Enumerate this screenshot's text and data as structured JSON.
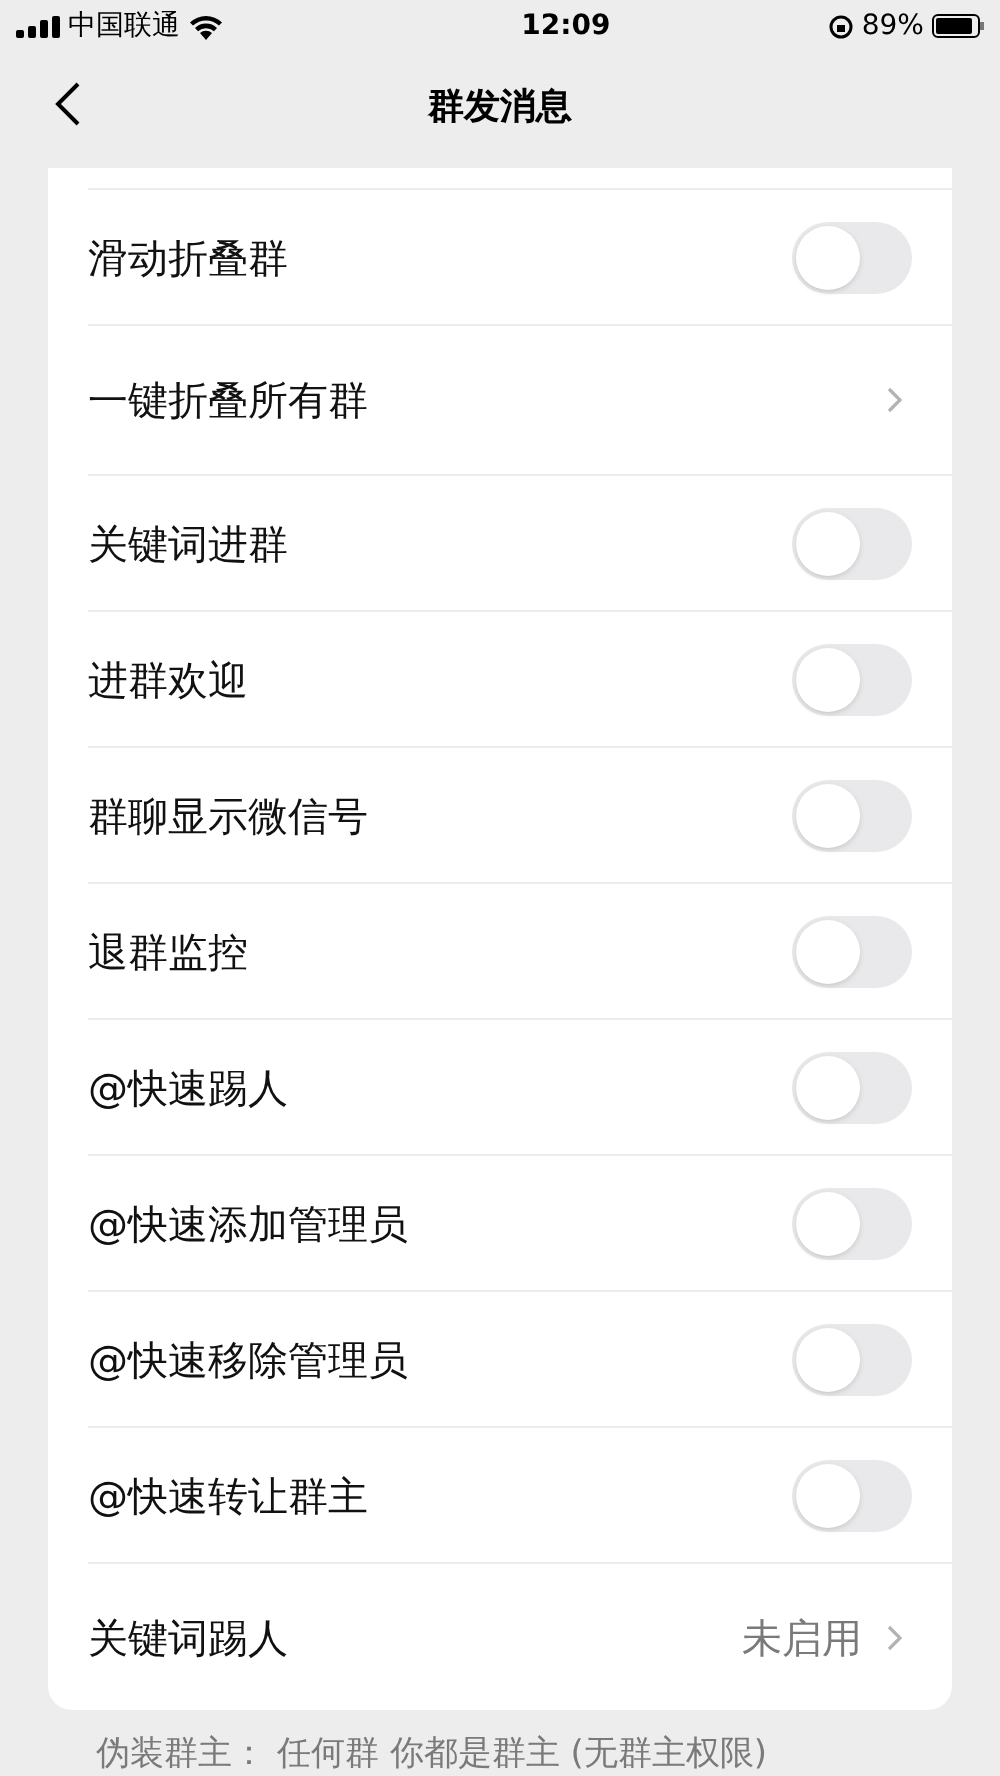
{
  "status_bar": {
    "carrier": "中国联通",
    "time": "12:09",
    "battery": "89%"
  },
  "nav": {
    "title": "群发消息"
  },
  "rows": [
    {
      "kind": "toggle",
      "label": "滑动折叠群",
      "on": false
    },
    {
      "kind": "link",
      "label": "一键折叠所有群"
    },
    {
      "kind": "toggle",
      "label": "关键词进群",
      "on": false
    },
    {
      "kind": "toggle",
      "label": "进群欢迎",
      "on": false
    },
    {
      "kind": "toggle",
      "label": "群聊显示微信号",
      "on": false
    },
    {
      "kind": "toggle",
      "label": "退群监控",
      "on": false
    },
    {
      "kind": "toggle",
      "label": "@快速踢人",
      "on": false
    },
    {
      "kind": "toggle",
      "label": "@快速添加管理员",
      "on": false
    },
    {
      "kind": "toggle",
      "label": "@快速移除管理员",
      "on": false
    },
    {
      "kind": "toggle",
      "label": "@快速转让群主",
      "on": false
    },
    {
      "kind": "link",
      "label": "关键词踢人",
      "value": "未启用"
    }
  ],
  "footer": "伪装群主： 任何群 你都是群主 (无群主权限)"
}
